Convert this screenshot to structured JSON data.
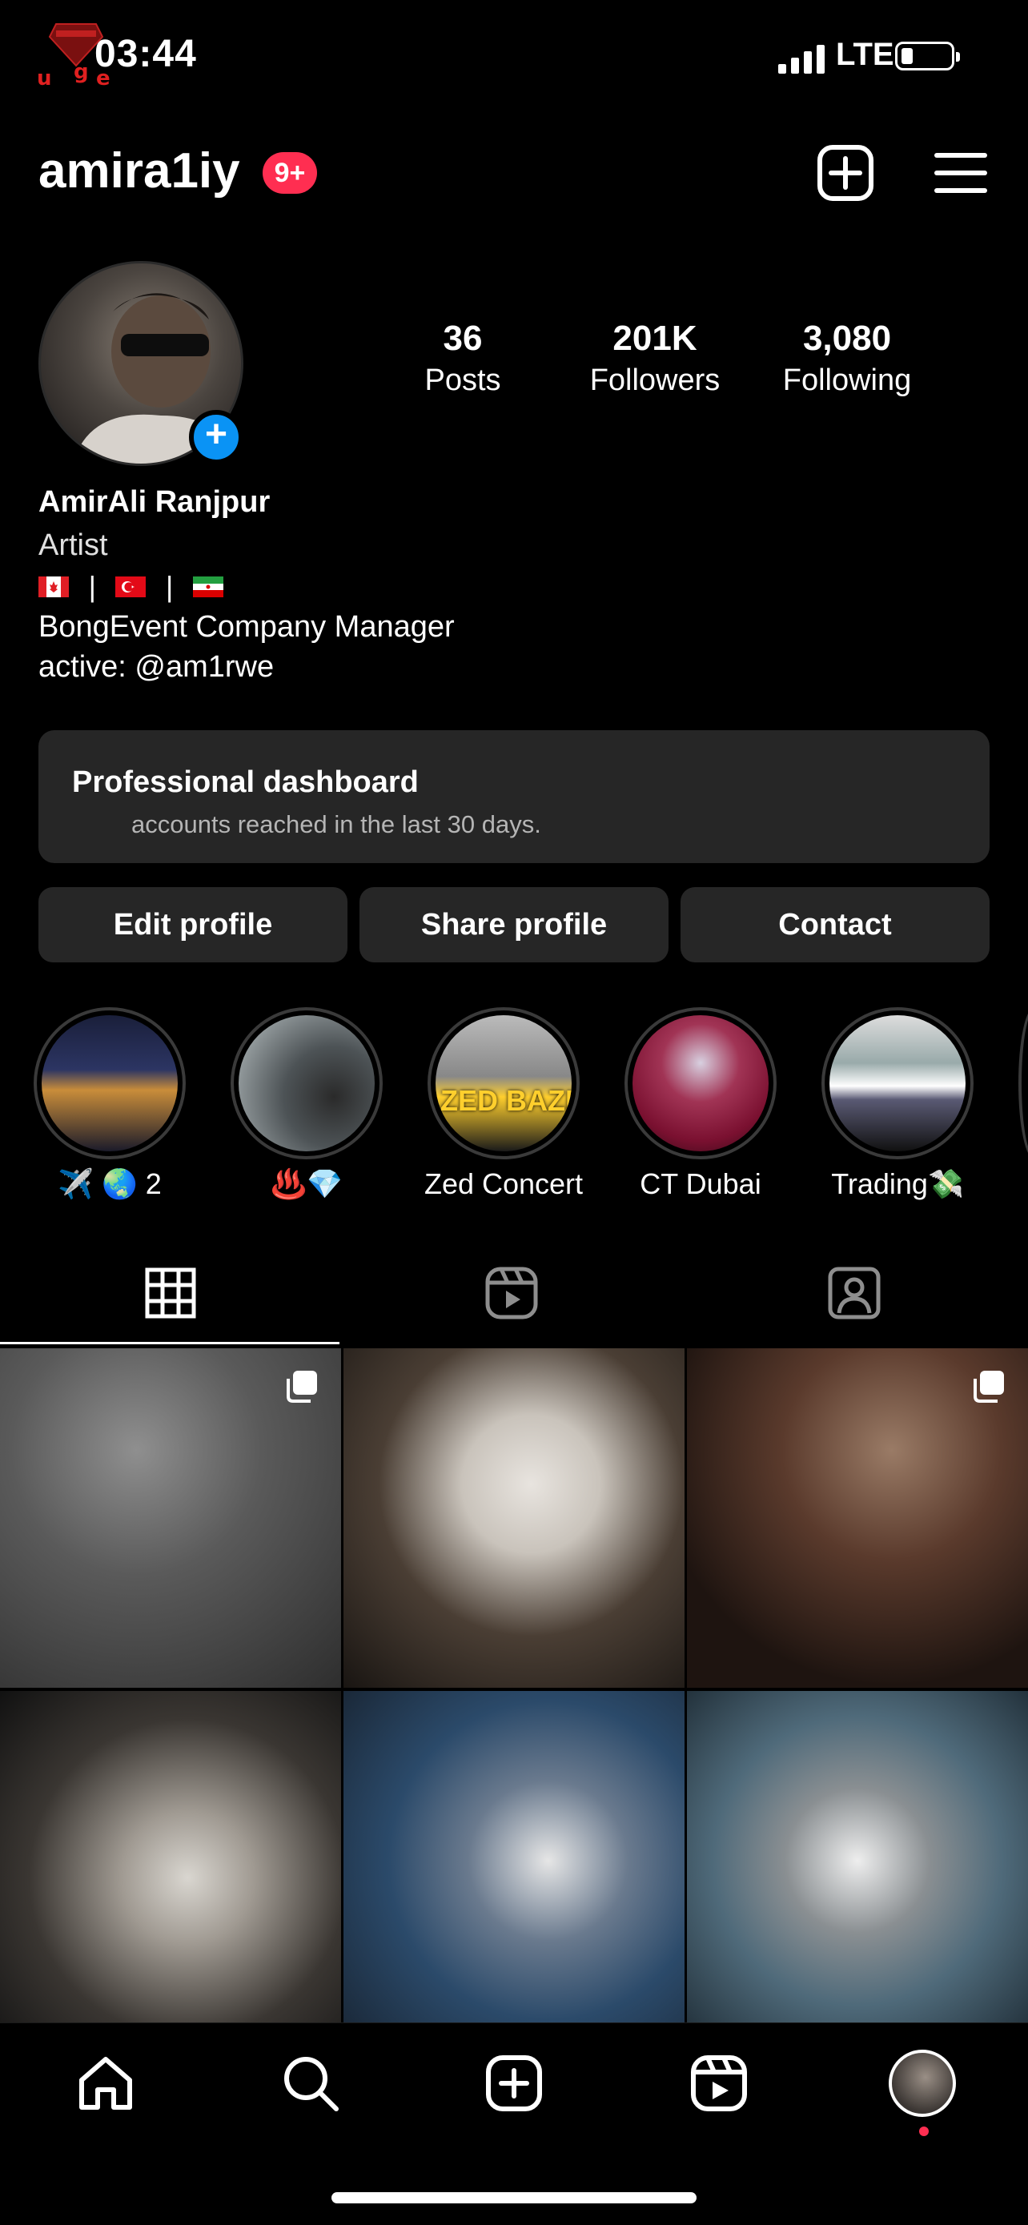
{
  "status_bar": {
    "time": "03:44",
    "network": "LTE",
    "watermark_text": "INFINITY u g e"
  },
  "header": {
    "username": "amira1iy",
    "badge": "9+",
    "icons": [
      "create-post-icon",
      "menu-icon"
    ]
  },
  "profile": {
    "stats": [
      {
        "value": "36",
        "label": "Posts"
      },
      {
        "value": "201K",
        "label": "Followers"
      },
      {
        "value": "3,080",
        "label": "Following"
      }
    ],
    "name": "AmirAli Ranjpur",
    "category": "Artist",
    "flags": [
      "canada-flag",
      "turkey-flag",
      "iran-flag"
    ],
    "flag_separator": "|",
    "bio_lines": [
      "BongEvent Company Manager",
      "active: @am1rwe"
    ]
  },
  "dashboard": {
    "title": "Professional dashboard",
    "subtitle": "accounts reached in the last 30 days."
  },
  "buttons": {
    "edit": "Edit profile",
    "share": "Share profile",
    "contact": "Contact"
  },
  "highlights": [
    {
      "label": "✈️ 🌏 2"
    },
    {
      "label": "♨️💎"
    },
    {
      "label": "Zed Concert",
      "cover_text": "ZED BAZI"
    },
    {
      "label": "CT Dubai"
    },
    {
      "label": "Trading💸"
    }
  ],
  "tabs": [
    "grid-icon",
    "reels-icon",
    "tagged-icon"
  ],
  "nav": [
    "home-icon",
    "search-icon",
    "create-icon",
    "reels-icon",
    "profile-avatar"
  ],
  "colors": {
    "accent_blue": "#0a93f5",
    "badge_red": "#ff2e51",
    "card_bg": "#262626"
  }
}
